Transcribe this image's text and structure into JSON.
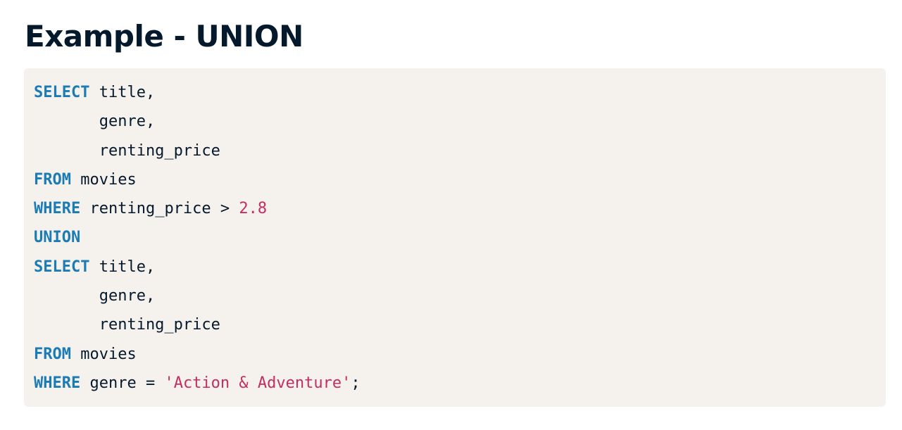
{
  "slide": {
    "title": "Example - UNION"
  },
  "code": {
    "lines": [
      [
        {
          "t": "SELECT",
          "k": "kw"
        },
        {
          "t": " title,",
          "k": "plain"
        }
      ],
      [
        {
          "t": "       genre,",
          "k": "plain"
        }
      ],
      [
        {
          "t": "       renting_price",
          "k": "plain"
        }
      ],
      [
        {
          "t": "FROM",
          "k": "kw"
        },
        {
          "t": " movies",
          "k": "plain"
        }
      ],
      [
        {
          "t": "WHERE",
          "k": "kw"
        },
        {
          "t": " renting_price > ",
          "k": "plain"
        },
        {
          "t": "2.8",
          "k": "num"
        }
      ],
      [
        {
          "t": "UNION",
          "k": "kw"
        }
      ],
      [
        {
          "t": "SELECT",
          "k": "kw"
        },
        {
          "t": " title,",
          "k": "plain"
        }
      ],
      [
        {
          "t": "       genre,",
          "k": "plain"
        }
      ],
      [
        {
          "t": "       renting_price",
          "k": "plain"
        }
      ],
      [
        {
          "t": "FROM",
          "k": "kw"
        },
        {
          "t": " movies",
          "k": "plain"
        }
      ],
      [
        {
          "t": "WHERE",
          "k": "kw"
        },
        {
          "t": " genre = ",
          "k": "plain"
        },
        {
          "t": "'Action & Adventure'",
          "k": "str"
        },
        {
          "t": ";",
          "k": "plain"
        }
      ]
    ]
  },
  "colors": {
    "title": "#05192d",
    "keyword": "#1b7bb5",
    "literal": "#c22d62",
    "code_background": "#f5f1ec"
  }
}
